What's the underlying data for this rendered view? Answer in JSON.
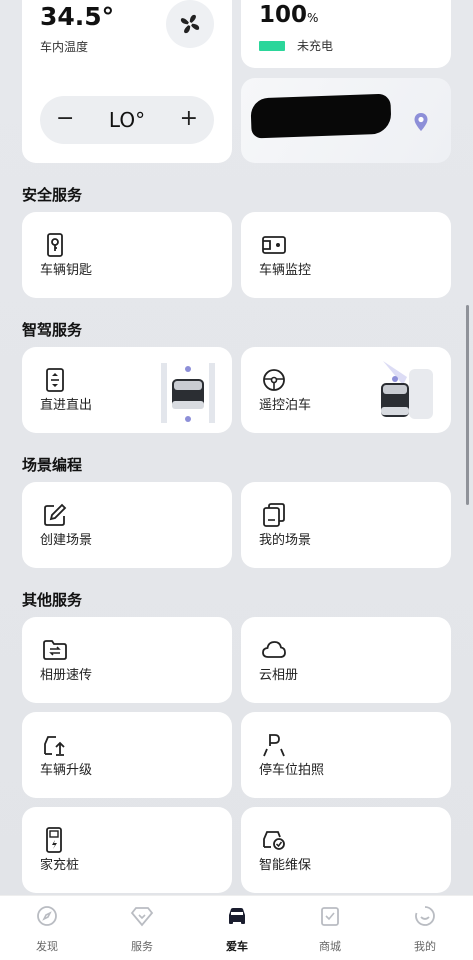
{
  "climate": {
    "temperature": "34.5°",
    "label": "车内温度",
    "setpoint": "LO°",
    "minus": "−",
    "plus": "+"
  },
  "battery": {
    "percent": "100",
    "unit": "%",
    "status": "未充电",
    "bar_color": "#2bd69a"
  },
  "sections": {
    "security": "安全服务",
    "smart_drive": "智驾服务",
    "scene": "场景编程",
    "other": "其他服务"
  },
  "tiles": {
    "car_key": "车辆钥匙",
    "car_monitor": "车辆监控",
    "straight_in_out": "直进直出",
    "remote_parking": "遥控泊车",
    "create_scene": "创建场景",
    "my_scene": "我的场景",
    "album_transfer": "相册速传",
    "cloud_album": "云相册",
    "car_upgrade": "车辆升级",
    "parking_photo": "停车位拍照",
    "home_charger": "家充桩",
    "smart_maintenance": "智能维保"
  },
  "nav": [
    {
      "label": "发现",
      "icon": "compass-icon"
    },
    {
      "label": "服务",
      "icon": "heart-badge-icon"
    },
    {
      "label": "爱车",
      "icon": "car-icon"
    },
    {
      "label": "商城",
      "icon": "shopping-bag-icon"
    },
    {
      "label": "我的",
      "icon": "smile-icon"
    }
  ],
  "nav_active_index": 2,
  "colors": {
    "accent": "#2bd69a",
    "pin": "#8d8fd8"
  }
}
